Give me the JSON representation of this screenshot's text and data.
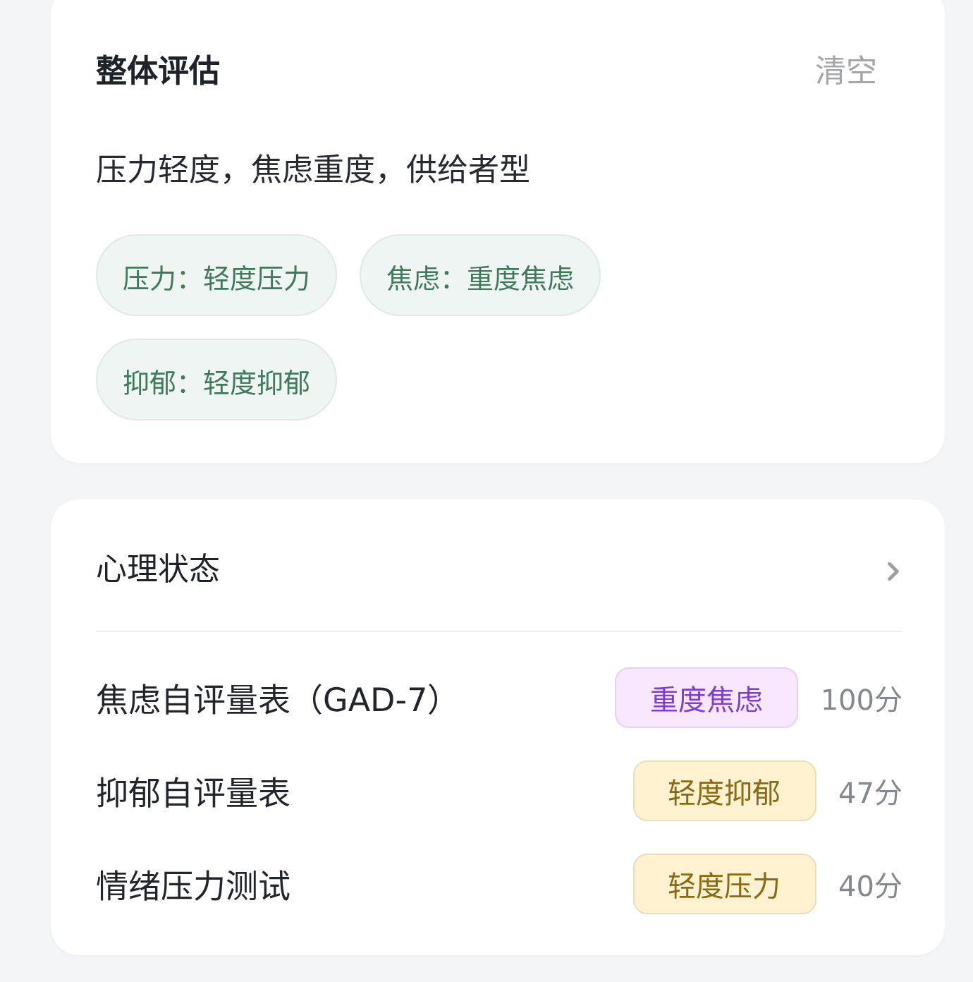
{
  "overall": {
    "title": "整体评估",
    "clear_button": "清空",
    "summary": "压力轻度，焦虑重度，供给者型",
    "tags": [
      "压力：轻度压力",
      "焦虑：重度焦虑",
      "抑郁：轻度抑郁"
    ]
  },
  "mental_state": {
    "title": "心理状态",
    "scales": [
      {
        "name": "焦虑自评量表（GAD-7）",
        "badge": {
          "label": "重度焦虑",
          "color": "#7b3fd6"
        },
        "score": "100分"
      },
      {
        "name": "抑郁自评量表",
        "badge": {
          "label": "轻度抑郁",
          "color": "#8a6a12"
        },
        "score": "47分"
      },
      {
        "name": "情绪压力测试",
        "badge": {
          "label": "轻度压力",
          "color": "#8a6a12"
        },
        "score": "40分"
      }
    ]
  }
}
